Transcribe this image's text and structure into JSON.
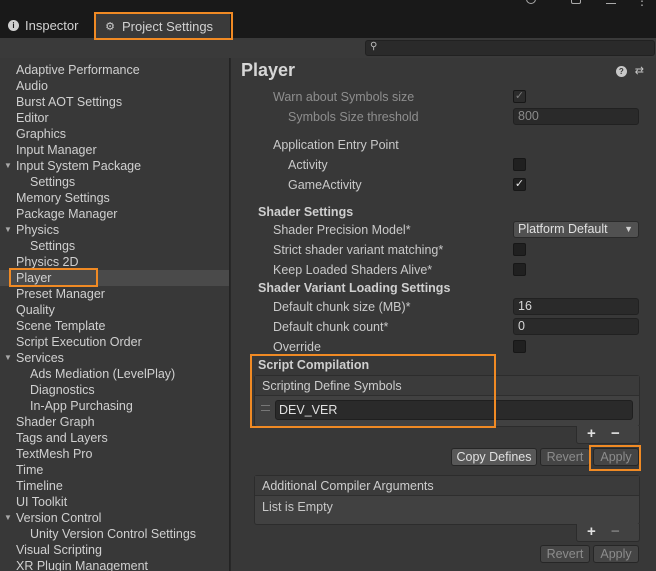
{
  "tabs": {
    "inspector": "Inspector",
    "project_settings": "Project Settings"
  },
  "search": {
    "placeholder": ""
  },
  "sidebar": {
    "items": [
      {
        "label": "Adaptive Performance",
        "indent": 0
      },
      {
        "label": "Audio",
        "indent": 0
      },
      {
        "label": "Burst AOT Settings",
        "indent": 0
      },
      {
        "label": "Editor",
        "indent": 0
      },
      {
        "label": "Graphics",
        "indent": 0
      },
      {
        "label": "Input Manager",
        "indent": 0
      },
      {
        "label": "Input System Package",
        "indent": 0,
        "expanded": true
      },
      {
        "label": "Settings",
        "indent": 1
      },
      {
        "label": "Memory Settings",
        "indent": 0
      },
      {
        "label": "Package Manager",
        "indent": 0
      },
      {
        "label": "Physics",
        "indent": 0,
        "expanded": true
      },
      {
        "label": "Settings",
        "indent": 1
      },
      {
        "label": "Physics 2D",
        "indent": 0
      },
      {
        "label": "Player",
        "indent": 0,
        "selected": true
      },
      {
        "label": "Preset Manager",
        "indent": 0
      },
      {
        "label": "Quality",
        "indent": 0
      },
      {
        "label": "Scene Template",
        "indent": 0
      },
      {
        "label": "Script Execution Order",
        "indent": 0
      },
      {
        "label": "Services",
        "indent": 0,
        "expanded": true
      },
      {
        "label": "Ads Mediation (LevelPlay)",
        "indent": 1
      },
      {
        "label": "Diagnostics",
        "indent": 1
      },
      {
        "label": "In-App Purchasing",
        "indent": 1
      },
      {
        "label": "Shader Graph",
        "indent": 0
      },
      {
        "label": "Tags and Layers",
        "indent": 0
      },
      {
        "label": "TextMesh Pro",
        "indent": 0
      },
      {
        "label": "Time",
        "indent": 0
      },
      {
        "label": "Timeline",
        "indent": 0
      },
      {
        "label": "UI Toolkit",
        "indent": 0
      },
      {
        "label": "Version Control",
        "indent": 0,
        "expanded": true
      },
      {
        "label": "Unity Version Control Settings",
        "indent": 1
      },
      {
        "label": "Visual Scripting",
        "indent": 0
      },
      {
        "label": "XR Plugin Management",
        "indent": 0
      }
    ]
  },
  "main": {
    "title": "Player",
    "warn_symbols_size": "Warn about Symbols size",
    "symbols_size_threshold": "Symbols Size threshold",
    "symbols_size_threshold_value": "800",
    "app_entry_point": "Application Entry Point",
    "activity": "Activity",
    "game_activity": "GameActivity",
    "shader_settings": "Shader Settings",
    "shader_precision_model": "Shader Precision Model*",
    "shader_precision_value": "Platform Default",
    "strict_shader_variant": "Strict shader variant matching*",
    "keep_loaded_shaders": "Keep Loaded Shaders Alive*",
    "shader_variant_loading": "Shader Variant Loading Settings",
    "default_chunk_size": "Default chunk size (MB)*",
    "default_chunk_size_value": "16",
    "default_chunk_count": "Default chunk count*",
    "default_chunk_count_value": "0",
    "override": "Override",
    "script_compilation": "Script Compilation",
    "scripting_define_symbols": "Scripting Define Symbols",
    "define_symbol_entry": "DEV_VER",
    "copy_defines": "Copy Defines",
    "revert": "Revert",
    "apply": "Apply",
    "additional_compiler_args": "Additional Compiler Arguments",
    "list_empty": "List is Empty",
    "revert2": "Revert",
    "apply2": "Apply"
  },
  "colors": {
    "highlight": "#f08a24",
    "panel": "#383838",
    "tabbar": "#191919"
  }
}
